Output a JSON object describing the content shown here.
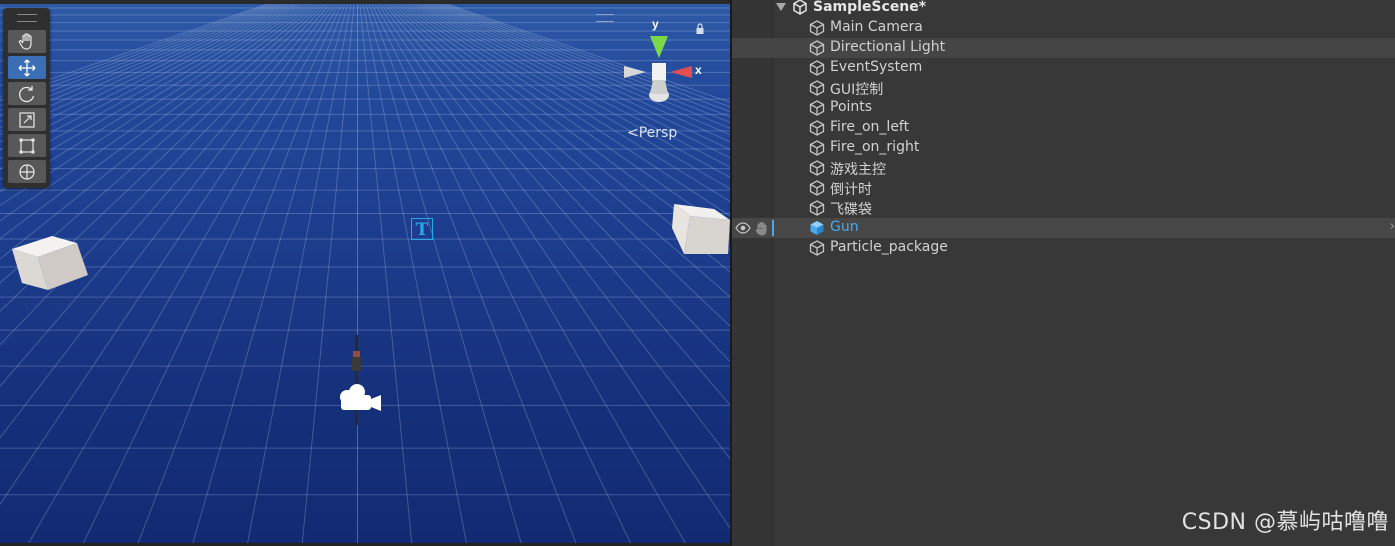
{
  "scene_view": {
    "camera_mode": "Persp",
    "axis_labels": {
      "x": "x",
      "y": "y"
    },
    "tools": [
      {
        "name": "hand-tool",
        "icon": "hand-icon",
        "active": false
      },
      {
        "name": "move-tool",
        "icon": "move-icon",
        "active": true
      },
      {
        "name": "rotate-tool",
        "icon": "rotate-icon",
        "active": false
      },
      {
        "name": "scale-tool",
        "icon": "scale-icon",
        "active": false
      },
      {
        "name": "rect-tool",
        "icon": "rect-icon",
        "active": false
      },
      {
        "name": "transform-tool",
        "icon": "transform-icon",
        "active": false
      }
    ],
    "text_gizmo": "T"
  },
  "hierarchy": {
    "scene_name": "SampleScene*",
    "items": [
      {
        "label": "Main Camera"
      },
      {
        "label": "Directional Light"
      },
      {
        "label": "EventSystem"
      },
      {
        "label": "GUI控制"
      },
      {
        "label": "Points"
      },
      {
        "label": "Fire_on_left"
      },
      {
        "label": "Fire_on_right"
      },
      {
        "label": "游戏主控"
      },
      {
        "label": "倒计时"
      },
      {
        "label": "飞碟袋"
      },
      {
        "label": "Gun"
      },
      {
        "label": "Particle_package"
      }
    ],
    "selected": "Gun",
    "hovered": "Directional Light"
  },
  "watermark": "CSDN @慕屿咕噜噜",
  "colors": {
    "accent": "#4aa8ec",
    "scene_bg": "#1c3c8c",
    "panel_bg": "#383838"
  }
}
